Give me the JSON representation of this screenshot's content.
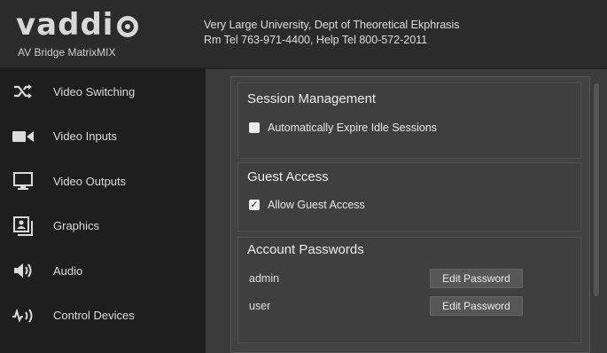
{
  "header": {
    "logo_text": "vaddi",
    "product": "AV Bridge MatrixMIX",
    "org_line1": "Very Large University, Dept of Theoretical Ekphrasis",
    "org_line2": "Rm Tel 763-971-4400, Help Tel 800-572-2011"
  },
  "sidebar": {
    "items": [
      {
        "label": "Video Switching",
        "icon": "shuffle-icon"
      },
      {
        "label": "Video Inputs",
        "icon": "camera-icon"
      },
      {
        "label": "Video Outputs",
        "icon": "monitor-icon"
      },
      {
        "label": "Graphics",
        "icon": "graphics-icon"
      },
      {
        "label": "Audio",
        "icon": "speaker-icon"
      },
      {
        "label": "Control Devices",
        "icon": "control-icon"
      }
    ]
  },
  "session": {
    "title": "Session Management",
    "expire_label": "Automatically Expire Idle Sessions",
    "expire_checked": false
  },
  "guest": {
    "title": "Guest Access",
    "allow_label": "Allow Guest Access",
    "allow_checked": true,
    "check_glyph": "✓"
  },
  "passwords": {
    "title": "Account Passwords",
    "users": [
      {
        "name": "admin",
        "button": "Edit Password"
      },
      {
        "name": "user",
        "button": "Edit Password"
      }
    ]
  }
}
